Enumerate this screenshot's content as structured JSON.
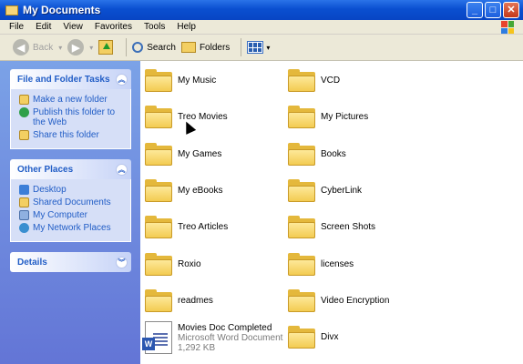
{
  "window": {
    "title": "My Documents"
  },
  "menu": [
    "File",
    "Edit",
    "View",
    "Favorites",
    "Tools",
    "Help"
  ],
  "toolbar": {
    "back": "Back",
    "search": "Search",
    "folders": "Folders"
  },
  "tasks_panel": {
    "title": "File and Folder Tasks",
    "items": [
      "Make a new folder",
      "Publish this folder to the Web",
      "Share this folder"
    ]
  },
  "places_panel": {
    "title": "Other Places",
    "items": [
      "Desktop",
      "Shared Documents",
      "My Computer",
      "My Network Places"
    ]
  },
  "details_panel": {
    "title": "Details"
  },
  "items": [
    {
      "name": "My Music",
      "type": "folder"
    },
    {
      "name": "VCD",
      "type": "folder"
    },
    {
      "name": "Treo Movies",
      "type": "folder"
    },
    {
      "name": "My Pictures",
      "type": "folder"
    },
    {
      "name": "My Games",
      "type": "folder"
    },
    {
      "name": "Books",
      "type": "folder"
    },
    {
      "name": "My eBooks",
      "type": "folder"
    },
    {
      "name": "CyberLink",
      "type": "folder"
    },
    {
      "name": "Treo Articles",
      "type": "folder"
    },
    {
      "name": "Screen Shots",
      "type": "folder"
    },
    {
      "name": "Roxio",
      "type": "folder"
    },
    {
      "name": "licenses",
      "type": "folder"
    },
    {
      "name": "readmes",
      "type": "folder"
    },
    {
      "name": "Video Encryption",
      "type": "folder"
    },
    {
      "name": "Movies Doc Completed",
      "type": "document",
      "subtitle": "Microsoft Word Document",
      "size": "1,292 KB"
    },
    {
      "name": "Divx",
      "type": "folder"
    }
  ]
}
